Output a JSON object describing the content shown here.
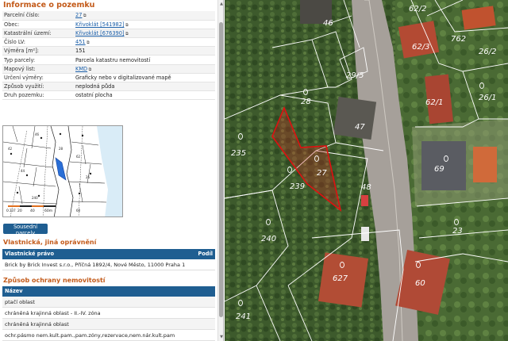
{
  "panel": {
    "title": "Informace o pozemku",
    "rows": [
      {
        "label": "Parcelní číslo:",
        "value": "27",
        "link": true
      },
      {
        "label": "Obec:",
        "value": "Křivoklát [541982]",
        "link": true
      },
      {
        "label": "Katastrální území:",
        "value": "Křivoklát [676390]",
        "link": true
      },
      {
        "label": "Číslo LV:",
        "value": "451",
        "link": true
      },
      {
        "label": "Výměra [m²]:",
        "value": "151",
        "link": false
      },
      {
        "label": "Typ parcely:",
        "value": "Parcela katastru nemovitostí",
        "link": false
      },
      {
        "label": "Mapový list:",
        "value": "KMD",
        "link": true
      },
      {
        "label": "Určení výměry:",
        "value": "Graficky nebo v digitalizované mapě",
        "link": false
      },
      {
        "label": "Způsob využití:",
        "value": "neplodná půda",
        "link": false
      },
      {
        "label": "Druh pozemku:",
        "value": "ostatní plocha",
        "link": false
      }
    ],
    "minimap": {
      "scale_labels": [
        "0",
        "20",
        "40",
        "60m"
      ]
    },
    "neighbors_button": "Sousední parcely",
    "owners": {
      "heading": "Vlastnická, jiná oprávnění",
      "col_owner": "Vlastnické právo",
      "col_share": "Podíl",
      "row": "Brick by Brick Invest s.r.o., Příčná 1892/4, Nové Město, 11000 Praha 1"
    },
    "protection": {
      "heading": "Způsob ochrany nemovitostí",
      "col_name": "Název",
      "items": [
        "ptačí oblast",
        "chráněná krajinná oblast - II.-IV. zóna",
        "chráněná krajinná oblast",
        "ochr.pásmo nem.kult.pam.,pam.zóny,rezervace,nem.nár.kult.pam"
      ]
    }
  },
  "map": {
    "parcel_labels": [
      "46",
      "62/2",
      "762",
      "62/3",
      "26/2",
      "29/5",
      "28",
      "62/1",
      "26/1",
      "47",
      "235",
      "27",
      "69",
      "239",
      "48",
      "23",
      "240",
      "627",
      "60",
      "241"
    ],
    "colors": {
      "selected": "#e01010",
      "boundary": "#ffffff",
      "vegetation": "#37502a"
    }
  }
}
